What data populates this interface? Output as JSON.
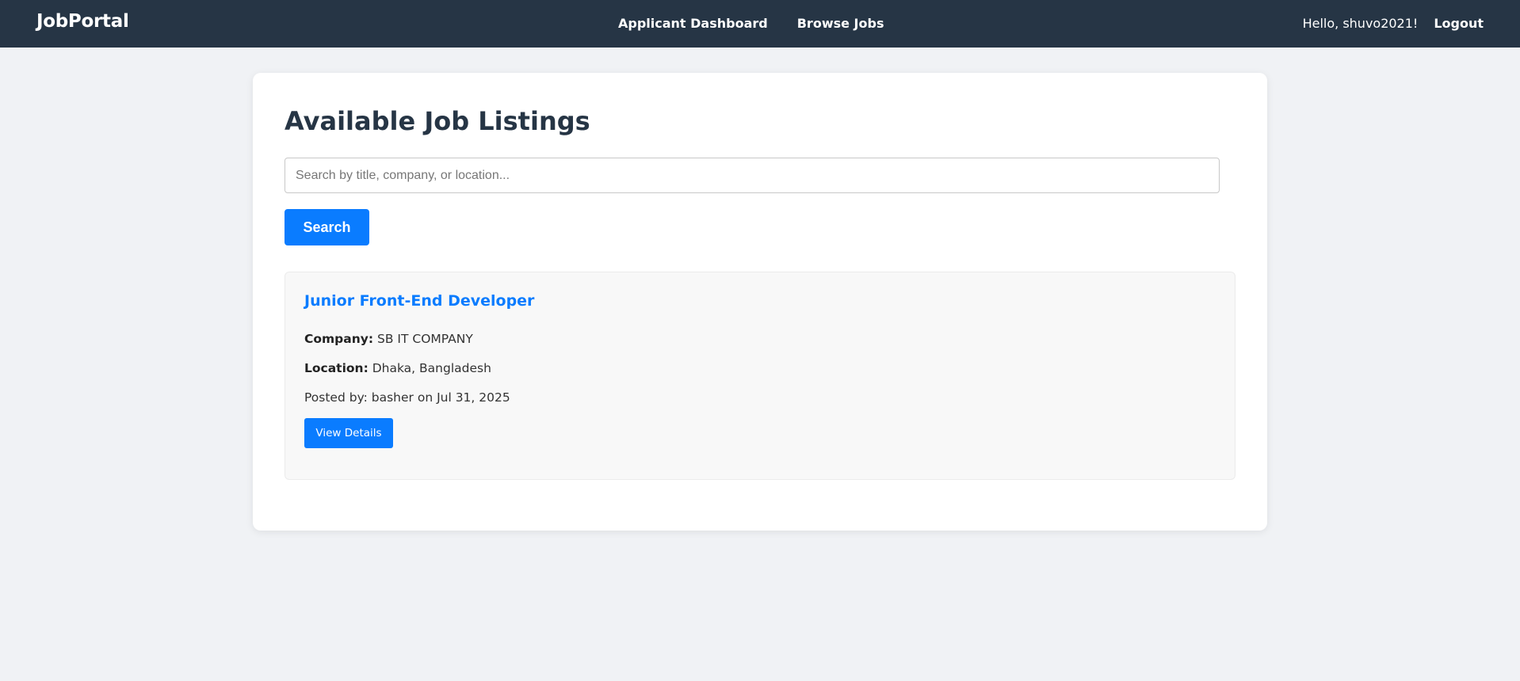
{
  "navbar": {
    "brand": "JobPortal",
    "links": [
      {
        "label": "Applicant Dashboard"
      },
      {
        "label": "Browse Jobs"
      }
    ],
    "greeting": "Hello, shuvo2021!",
    "logout_label": "Logout"
  },
  "main": {
    "title": "Available Job Listings",
    "search": {
      "placeholder": "Search by title, company, or location...",
      "value": "",
      "button_label": "Search"
    },
    "jobs": [
      {
        "title": "Junior Front-End Developer",
        "company_label": "Company:",
        "company": "SB IT COMPANY",
        "location_label": "Location:",
        "location": "Dhaka, Bangladesh",
        "posted": "Posted by: basher on Jul 31, 2025",
        "button_label": "View Details"
      }
    ]
  },
  "colors": {
    "navbar_bg": "#263545",
    "accent": "#0a7cff",
    "page_bg": "#f0f2f5"
  }
}
